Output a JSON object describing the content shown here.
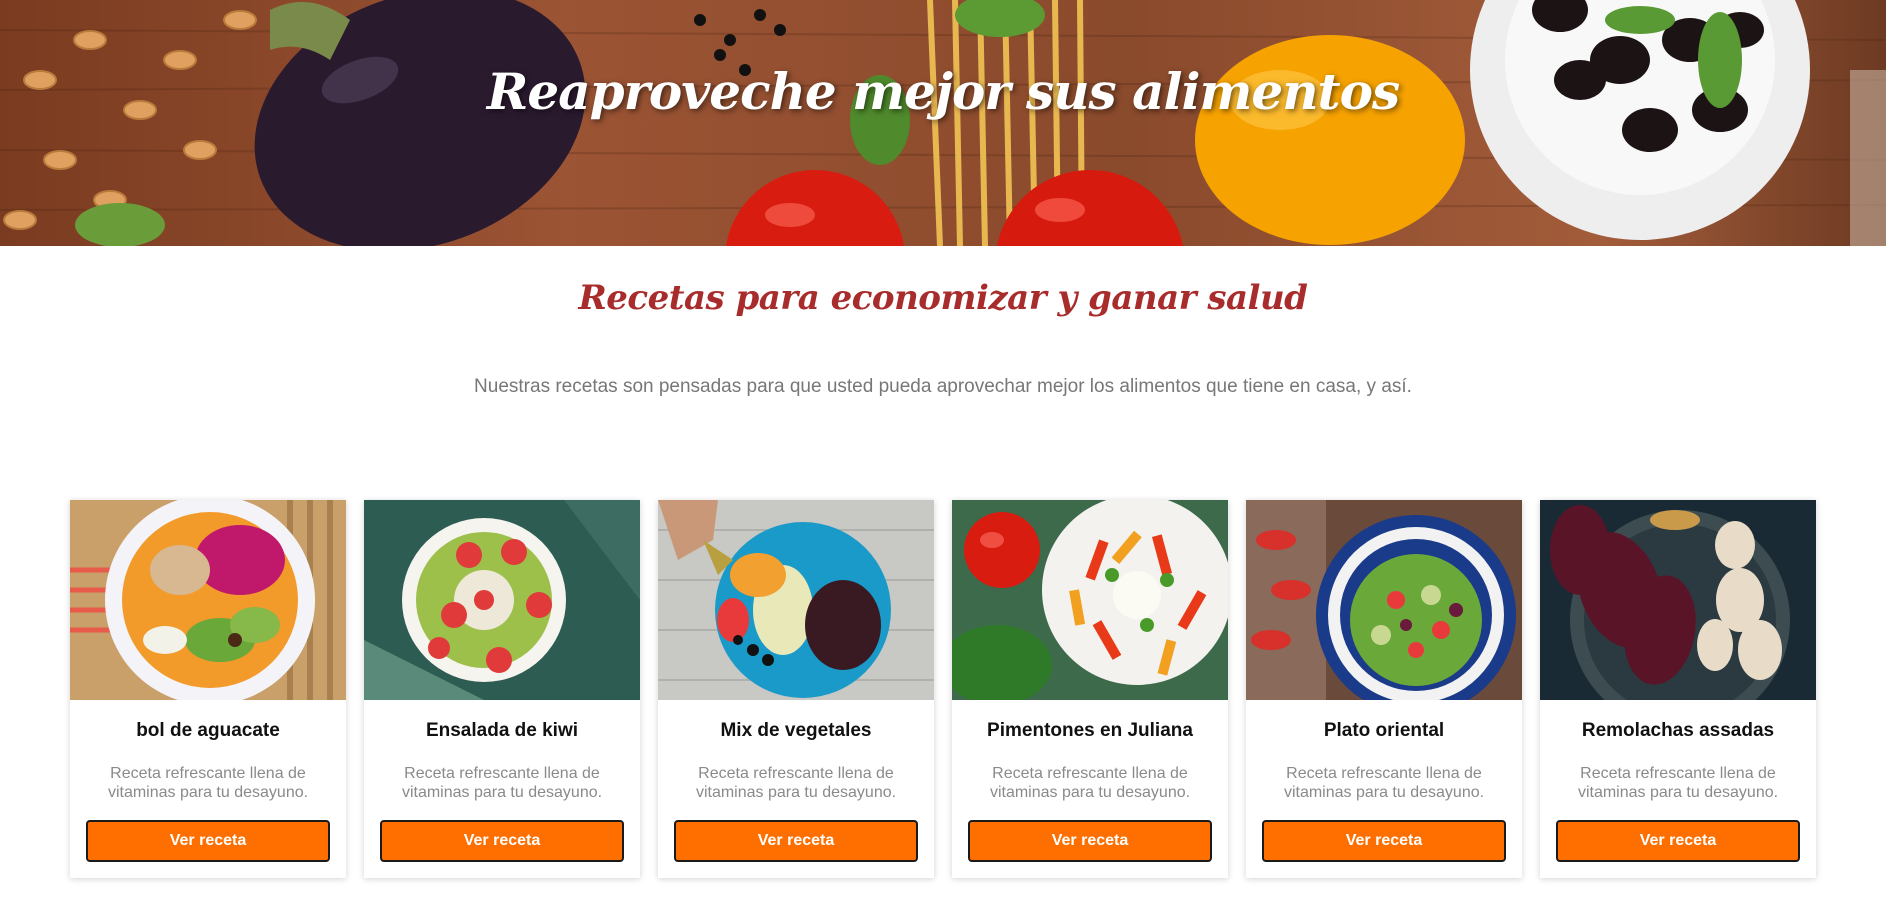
{
  "hero": {
    "title": "Reaproveche mejor sus alimentos"
  },
  "intro": {
    "title": "Recetas para economizar y ganar salud",
    "description": "Nuestras recetas son pensadas para que usted pueda aprovechar mejor los alimentos que tiene en casa, y así."
  },
  "colors": {
    "accent": "#ff6f00",
    "title_red": "#a82c2c",
    "muted_text": "#777777"
  },
  "recipes": [
    {
      "title": "bol de aguacate",
      "description": "Receta refrescante llena de vitaminas para tu desayuno.",
      "button": "Ver receta",
      "image": "avocado-bowl-photo"
    },
    {
      "title": "Ensalada de kiwi",
      "description": "Receta refrescante llena de vitaminas para tu desayuno.",
      "button": "Ver receta",
      "image": "kiwi-salad-photo"
    },
    {
      "title": "Mix de vegetales",
      "description": "Receta refrescante llena de vitaminas para tu desayuno.",
      "button": "Ver receta",
      "image": "vegetable-mix-photo"
    },
    {
      "title": "Pimentones en Juliana",
      "description": "Receta refrescante llena de vitaminas para tu desayuno.",
      "button": "Ver receta",
      "image": "julienne-peppers-photo"
    },
    {
      "title": "Plato oriental",
      "description": "Receta refrescante llena de vitaminas para tu desayuno.",
      "button": "Ver receta",
      "image": "oriental-dish-photo"
    },
    {
      "title": "Remolachas assadas",
      "description": "Receta refrescante llena de vitaminas para tu desayuno.",
      "button": "Ver receta",
      "image": "roasted-beets-photo"
    }
  ]
}
